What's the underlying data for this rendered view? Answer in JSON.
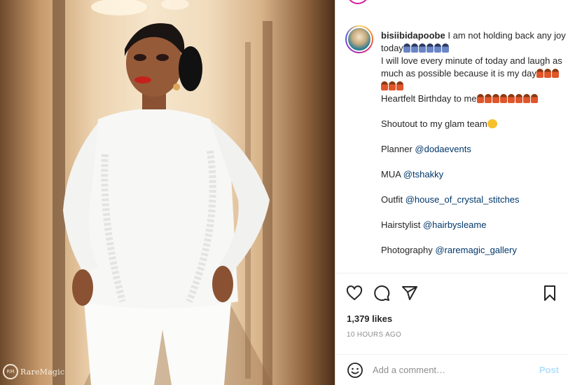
{
  "photo": {
    "alt": "Woman in a white ruffled outfit posing in a hallway",
    "watermark": "RareMagic",
    "watermark_sub": "RM"
  },
  "caption": {
    "username": "bisiibidapoobe",
    "line1": "I am not holding back any joy today",
    "line1_emoji": [
      "blue",
      "blue",
      "blue",
      "blue",
      "blue",
      "blue"
    ],
    "line2": "I will love every minute of today and laugh as much as possible because it is my day",
    "line2_emoji": [
      "red",
      "red",
      "red",
      "red",
      "red",
      "red"
    ],
    "line3": "Heartfelt Birthday to me",
    "line3_emoji": [
      "red",
      "red",
      "red",
      "red",
      "red",
      "red",
      "red",
      "red"
    ],
    "shoutout": "Shoutout to my glam team",
    "credits": [
      {
        "label": "Planner ",
        "handle": "@dodaevents"
      },
      {
        "label": "MUA ",
        "handle": "@tshakky"
      },
      {
        "label": "Outfit ",
        "handle": "@house_of_crystal_stitches"
      },
      {
        "label": "Hairstylist ",
        "handle": "@hairbysleame"
      },
      {
        "label": "Photography ",
        "handle": "@raremagic_gallery"
      }
    ]
  },
  "actions": {
    "icons": [
      "heart-icon",
      "comment-icon",
      "share-icon",
      "bookmark-icon"
    ]
  },
  "stats": {
    "likes": "1,379 likes",
    "time": "10 HOURS AGO"
  },
  "comment_box": {
    "placeholder": "Add a comment…",
    "post_label": "Post"
  },
  "colors": {
    "mention": "#00376b",
    "post_disabled": "#b2dffc",
    "muted": "#8e8e8e"
  }
}
